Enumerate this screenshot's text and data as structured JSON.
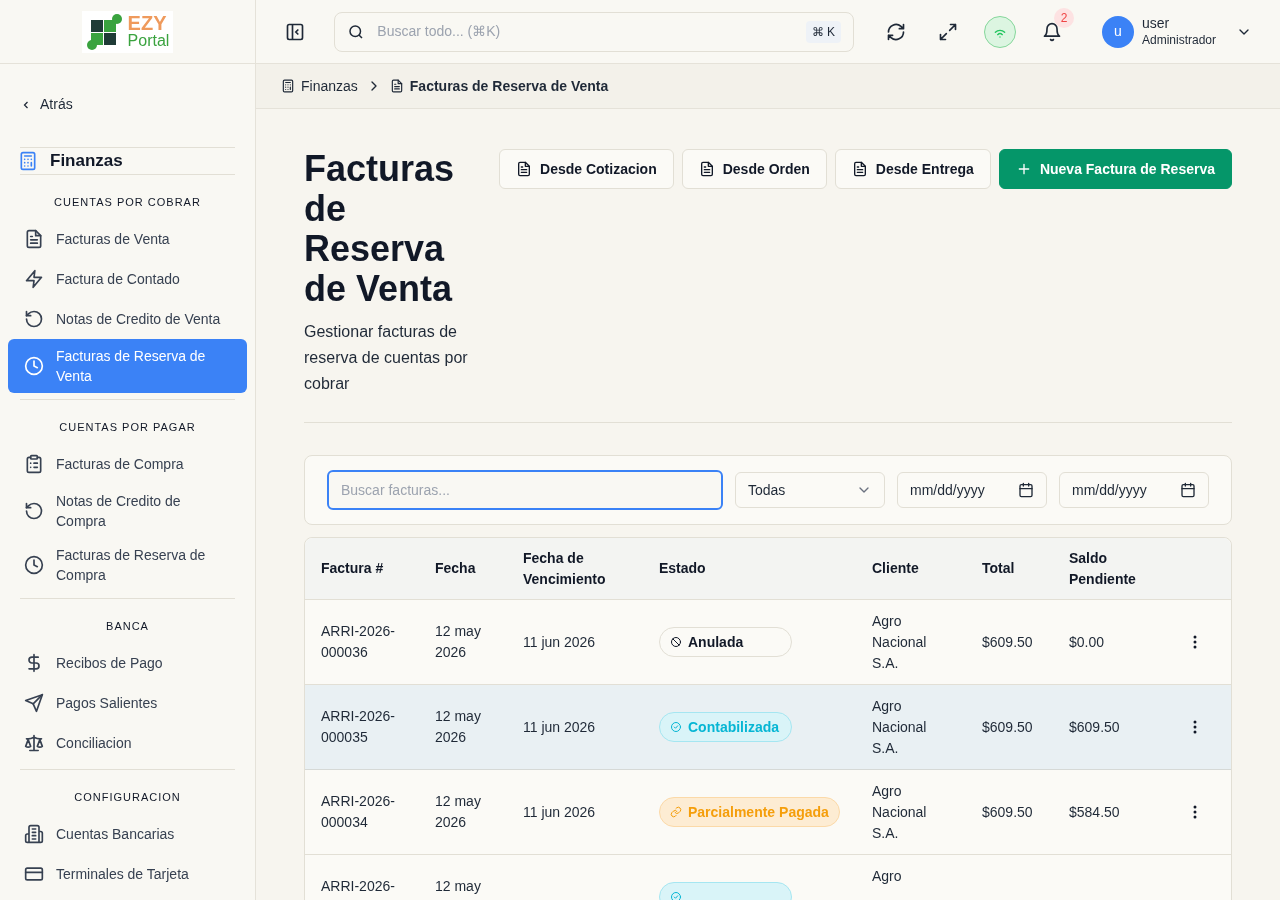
{
  "logo": {
    "word_1": "EZY",
    "word_2": "Portal"
  },
  "topbar": {
    "search_placeholder": "Buscar todo... (⌘K)",
    "shortcut": "⌘ K",
    "notifications": "2",
    "user": {
      "initial": "u",
      "name": "user",
      "role": "Administrador"
    }
  },
  "breadcrumb": [
    "Finanzas",
    "Facturas de Reserva de Venta"
  ],
  "sidebar": {
    "back": "Atrás",
    "module": "Finanzas",
    "sections": [
      {
        "title": "CUENTAS POR COBRAR",
        "items": [
          {
            "label": "Facturas de Venta",
            "selected": false
          },
          {
            "label": "Factura de Contado",
            "selected": false
          },
          {
            "label": "Notas de Credito de Venta",
            "selected": false
          },
          {
            "label": "Facturas de Reserva de Venta",
            "selected": true
          }
        ]
      },
      {
        "title": "CUENTAS POR PAGAR",
        "items": [
          {
            "label": "Facturas de Compra",
            "selected": false
          },
          {
            "label": "Notas de Credito de Compra",
            "selected": false
          },
          {
            "label": "Facturas de Reserva de Compra",
            "selected": false
          }
        ]
      },
      {
        "title": "BANCA",
        "items": [
          {
            "label": "Recibos de Pago",
            "selected": false
          },
          {
            "label": "Pagos Salientes",
            "selected": false
          },
          {
            "label": "Conciliacion",
            "selected": false
          }
        ]
      },
      {
        "title": "CONFIGURACION",
        "items": [
          {
            "label": "Cuentas Bancarias",
            "selected": false
          },
          {
            "label": "Terminales de Tarjeta",
            "selected": false
          }
        ]
      }
    ]
  },
  "page": {
    "title": "Facturas de Reserva de Venta",
    "subtitle": "Gestionar facturas de reserva de cuentas por cobrar",
    "actions": [
      {
        "label": "Desde Cotizacion",
        "kind": "secondary"
      },
      {
        "label": "Desde Orden",
        "kind": "secondary"
      },
      {
        "label": "Desde Entrega",
        "kind": "secondary"
      },
      {
        "label": "Nueva Factura de Reserva",
        "kind": "primary"
      }
    ]
  },
  "filters": {
    "search_placeholder": "Buscar facturas...",
    "status": "Todas",
    "date_from": "mm/dd/yyyy",
    "date_to": "mm/dd/yyyy"
  },
  "table": {
    "columns": [
      "Factura #",
      "Fecha",
      "Fecha de Vencimiento",
      "Estado",
      "Cliente",
      "Total",
      "Saldo Pendiente"
    ],
    "rows": [
      {
        "selected": false,
        "cells": [
          "ARRI-2026-000036",
          "12 may 2026",
          "11 jun 2026",
          {
            "kind": "void",
            "label": "Anulada"
          },
          "Agro Nacional S.A.",
          "$609.50",
          "$0.00"
        ]
      },
      {
        "selected": true,
        "cells": [
          "ARRI-2026-000035",
          "12 may 2026",
          "11 jun 2026",
          {
            "kind": "posted",
            "label": "Contabilizada"
          },
          "Agro Nacional S.A.",
          "$609.50",
          "$609.50"
        ]
      },
      {
        "selected": false,
        "cells": [
          "ARRI-2026-000034",
          "12 may 2026",
          "11 jun 2026",
          {
            "kind": "partial",
            "label": "Parcialmente Pagada"
          },
          "Agro Nacional S.A.",
          "$609.50",
          "$584.50"
        ]
      },
      {
        "selected": false,
        "cells": [
          "ARRI-2026-",
          "12 may",
          "",
          {
            "kind": "posted"
          },
          "Agro",
          "",
          ""
        ]
      }
    ]
  }
}
